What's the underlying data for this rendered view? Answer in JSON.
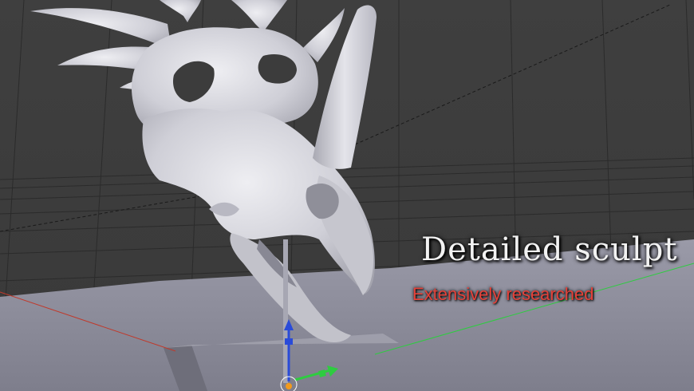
{
  "viewport": {
    "background_color": "#3d3d3d",
    "grid_color": "#2a2a2a",
    "floor_color": "#8c8c9a",
    "x_axis_color": "#c0392b",
    "y_axis_color": "#2ecc40",
    "z_axis_color": "#2a4bd8"
  },
  "model": {
    "object": "dinosaur-skull-sculpt",
    "material_color": "#d6d6dc"
  },
  "overlay": {
    "title": "Detailed sculpt",
    "subtitle": "Extensively researched",
    "title_color": "#f2f2f2",
    "subtitle_color": "#e4423a"
  }
}
